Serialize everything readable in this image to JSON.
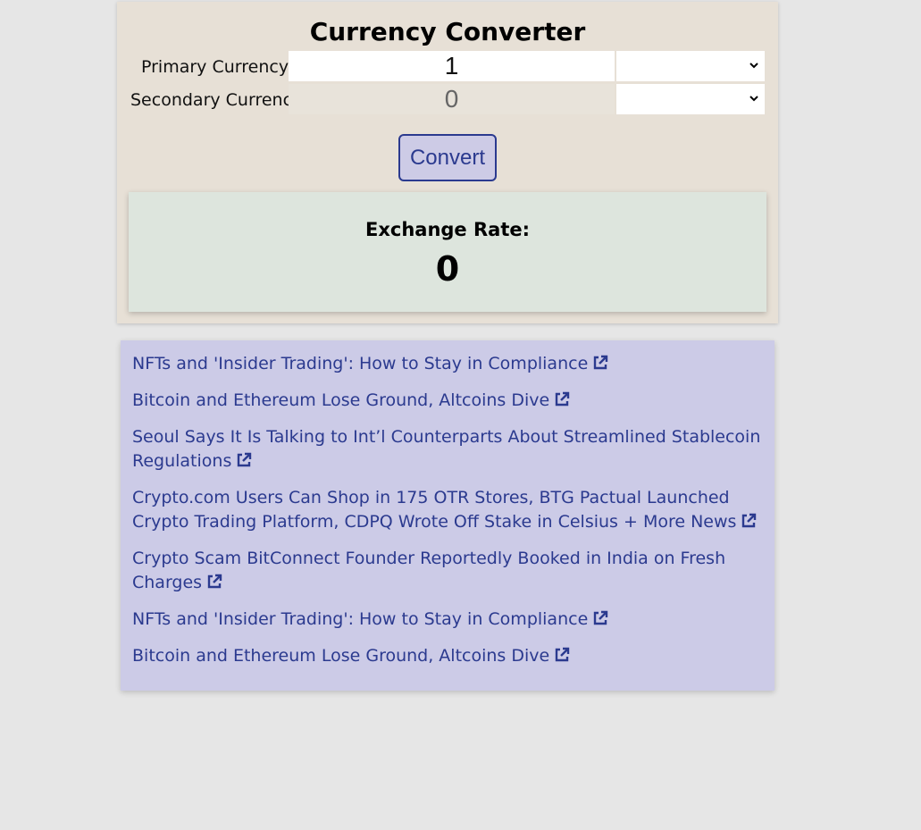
{
  "converter": {
    "title": "Currency Converter",
    "primary_label": "Primary Currency",
    "secondary_label": "Secondary Currency",
    "primary_value": "1",
    "secondary_value": "0",
    "primary_currency": "",
    "secondary_currency": "",
    "convert_label": "Convert"
  },
  "exchange": {
    "label": "Exchange Rate:",
    "value": "0"
  },
  "news": {
    "items": [
      {
        "title": "NFTs and 'Insider Trading': How to Stay in Compliance",
        "icon": "external-link-icon"
      },
      {
        "title": "Bitcoin and Ethereum Lose Ground, Altcoins Dive",
        "icon": "external-link-icon"
      },
      {
        "title": "Seoul Says It Is Talking to Int’l Counterparts About Streamlined Stablecoin Regulations",
        "icon": "external-link-icon"
      },
      {
        "title": "Crypto.com Users Can Shop in 175 OTR Stores, BTG Pactual Launched Crypto Trading Platform, CDPQ Wrote Off Stake in Celsius + More News",
        "icon": "external-link-icon"
      },
      {
        "title": "Crypto Scam BitConnect Founder Reportedly Booked in India on Fresh Charges",
        "icon": "external-link-icon"
      },
      {
        "title": "NFTs and 'Insider Trading': How to Stay in Compliance",
        "icon": "external-link-icon"
      },
      {
        "title": "Bitcoin and Ethereum Lose Ground, Altcoins Dive",
        "icon": "external-link-icon"
      }
    ]
  },
  "colors": {
    "page_bg": "#e6e6e6",
    "converter_bg": "#e7e0d6",
    "rate_bg": "#dde5dd",
    "news_bg": "#cccbe7",
    "link": "#2b3a8f"
  }
}
